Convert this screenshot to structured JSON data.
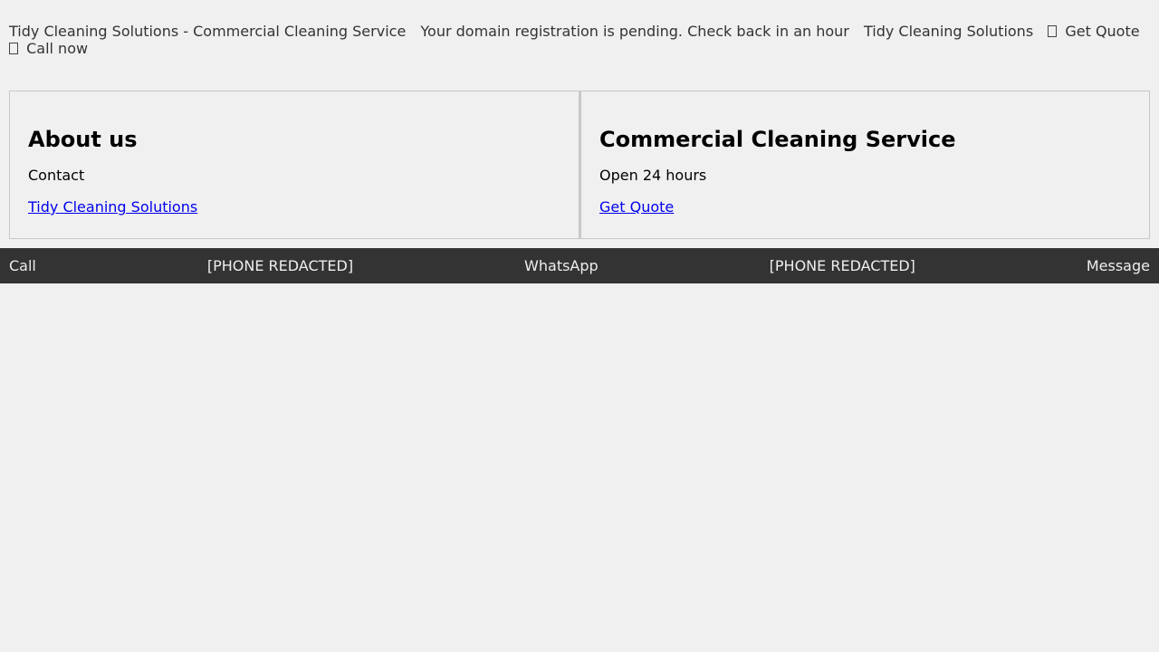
{
  "header": {
    "site_title": "Tidy Cleaning Solutions - Commercial Cleaning Service",
    "notice": "Your domain registration is pending. Check back in an hour",
    "brand": "Tidy Cleaning Solutions",
    "quote_icon": "missing-glyph-icon",
    "quote_label": "Get Quote",
    "call_icon": "missing-glyph-icon",
    "call_label": "Call now"
  },
  "about": {
    "heading": "About us",
    "contact_label": "Contact",
    "link_label": "Tidy Cleaning Solutions"
  },
  "service": {
    "heading": "Commercial Cleaning Service",
    "hours": "Open 24 hours",
    "link_label": "Get Quote"
  },
  "footer": {
    "call_label": "Call",
    "call_phone": "[PHONE REDACTED]",
    "whatsapp_label": "WhatsApp",
    "whatsapp_phone": "[PHONE REDACTED]",
    "message_label": "Message"
  },
  "colors": {
    "background": "#f0f0f0",
    "footer_bg": "#333333",
    "link": "#0000ee"
  }
}
